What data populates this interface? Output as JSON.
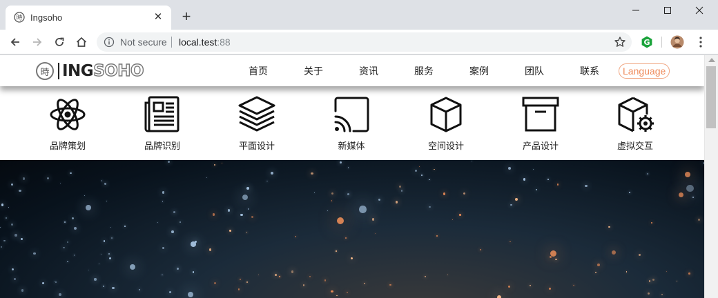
{
  "browser": {
    "tab_title": "Ingsoho",
    "tab_close": "✕",
    "new_tab": "+",
    "omnibox": {
      "security_label": "Not secure",
      "host": "local.test",
      "port": ":88"
    }
  },
  "site": {
    "logo": {
      "seal_char": "時",
      "brand_a": "ING",
      "brand_b": "SOHO"
    },
    "nav": [
      "首页",
      "关于",
      "资讯",
      "服务",
      "案例",
      "团队",
      "联系"
    ],
    "language_button": "Language",
    "services": [
      {
        "label": "品牌策划",
        "icon": "atom-icon"
      },
      {
        "label": "品牌识别",
        "icon": "newspaper-icon"
      },
      {
        "label": "平面设计",
        "icon": "layers-icon"
      },
      {
        "label": "新媒体",
        "icon": "cast-icon"
      },
      {
        "label": "空间设计",
        "icon": "box-icon"
      },
      {
        "label": "产品设计",
        "icon": "archive-icon"
      },
      {
        "label": "虚拟交互",
        "icon": "box-gear-icon"
      }
    ]
  },
  "colors": {
    "accent": "#ef8a5a",
    "chrome_bg": "#dee1e6",
    "hero_dark": "#08121c"
  }
}
